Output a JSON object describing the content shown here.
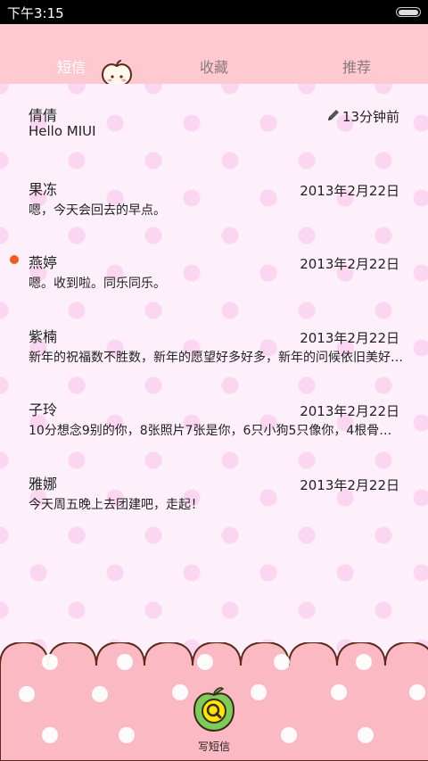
{
  "status_bar": {
    "time": "下午3:15"
  },
  "tabs": [
    {
      "label": "短信",
      "active": true
    },
    {
      "label": "收藏",
      "active": false
    },
    {
      "label": "推荐",
      "active": false
    }
  ],
  "conversations": [
    {
      "name": "倩倩",
      "date": "13分钟前",
      "preview": "Hello MIUI",
      "unread": false,
      "draft": true
    },
    {
      "name": "果冻",
      "date": "2013年2月22日",
      "preview": "嗯，今天会回去的早点。",
      "unread": false,
      "draft": false
    },
    {
      "name": "燕婷",
      "date": "2013年2月22日",
      "preview": "嗯。收到啦。同乐同乐。",
      "unread": true,
      "draft": false
    },
    {
      "name": "紫楠",
      "date": "2013年2月22日",
      "preview": "新年的祝福数不胜数，新年的愿望好多好多，新年的问候依旧美好…",
      "unread": false,
      "draft": false
    },
    {
      "name": "子玲",
      "date": "2013年2月22日",
      "preview": "10分想念9别的你，8张照片7张是你，6只小狗5只像你，4根骨头…",
      "unread": false,
      "draft": false
    },
    {
      "name": "雅娜",
      "date": "2013年2月22日",
      "preview": "今天周五晚上去团建吧，走起！",
      "unread": false,
      "draft": false
    }
  ],
  "compose": {
    "label": "写短信",
    "icon": "compose-apple-icon"
  },
  "colors": {
    "header_bg": "#ffc9d2",
    "list_bg": "#fdf0fa",
    "dot": "#fbd6f1",
    "bottom_bg": "#fbb9c4",
    "unread": "#f25a1f",
    "accent_green": "#6cc04a",
    "accent_yellow": "#ffe600"
  }
}
